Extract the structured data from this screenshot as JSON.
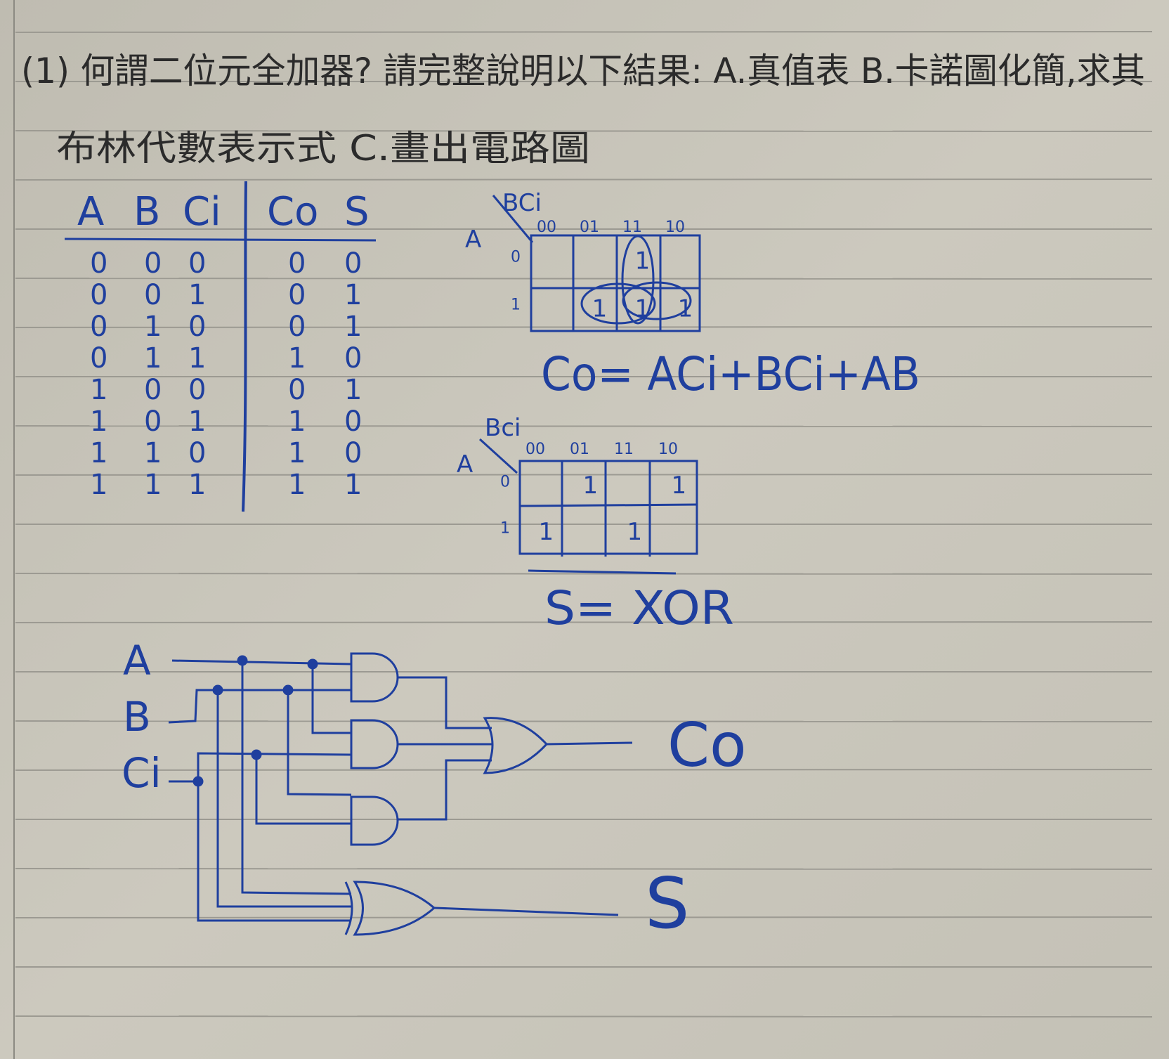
{
  "question": {
    "line1": "(1) 何謂二位元全加器? 請完整說明以下結果: A.真值表 B.卡諾圖化簡,求其",
    "line2": "布林代數表示式 C.畫出電路圖"
  },
  "truth_table": {
    "inputs": [
      "A",
      "B",
      "Ci"
    ],
    "outputs": [
      "Co",
      "S"
    ],
    "rows": [
      [
        "0",
        "0",
        "0",
        "0",
        "0"
      ],
      [
        "0",
        "0",
        "1",
        "0",
        "1"
      ],
      [
        "0",
        "1",
        "0",
        "0",
        "1"
      ],
      [
        "0",
        "1",
        "1",
        "1",
        "0"
      ],
      [
        "1",
        "0",
        "0",
        "0",
        "1"
      ],
      [
        "1",
        "0",
        "1",
        "1",
        "0"
      ],
      [
        "1",
        "1",
        "0",
        "1",
        "0"
      ],
      [
        "1",
        "1",
        "1",
        "1",
        "1"
      ]
    ]
  },
  "kmap_co": {
    "row_var": "A",
    "col_var": "BCi",
    "col_labels": [
      "00",
      "01",
      "11",
      "10"
    ],
    "row_labels": [
      "0",
      "1"
    ],
    "cells": [
      [
        "",
        "",
        "1",
        ""
      ],
      [
        "",
        "1",
        "1",
        "1"
      ]
    ],
    "equation": "Co= ACi+BCi+AB"
  },
  "kmap_s": {
    "row_var": "A",
    "col_var": "Bci",
    "col_labels": [
      "00",
      "01",
      "11",
      "10"
    ],
    "row_labels": [
      "0",
      "1"
    ],
    "cells": [
      [
        "",
        "1",
        "",
        "1"
      ],
      [
        "1",
        "",
        "1",
        ""
      ]
    ],
    "equation": "S= XOR"
  },
  "circuit": {
    "inputs": [
      "A",
      "B",
      "Ci"
    ],
    "outputs": [
      "Co",
      "S"
    ]
  },
  "colors": {
    "ink": "#1f3f9e",
    "pencil": "#2b2b2b",
    "paper": "#c9c6bb",
    "rule": "#9a9890"
  }
}
